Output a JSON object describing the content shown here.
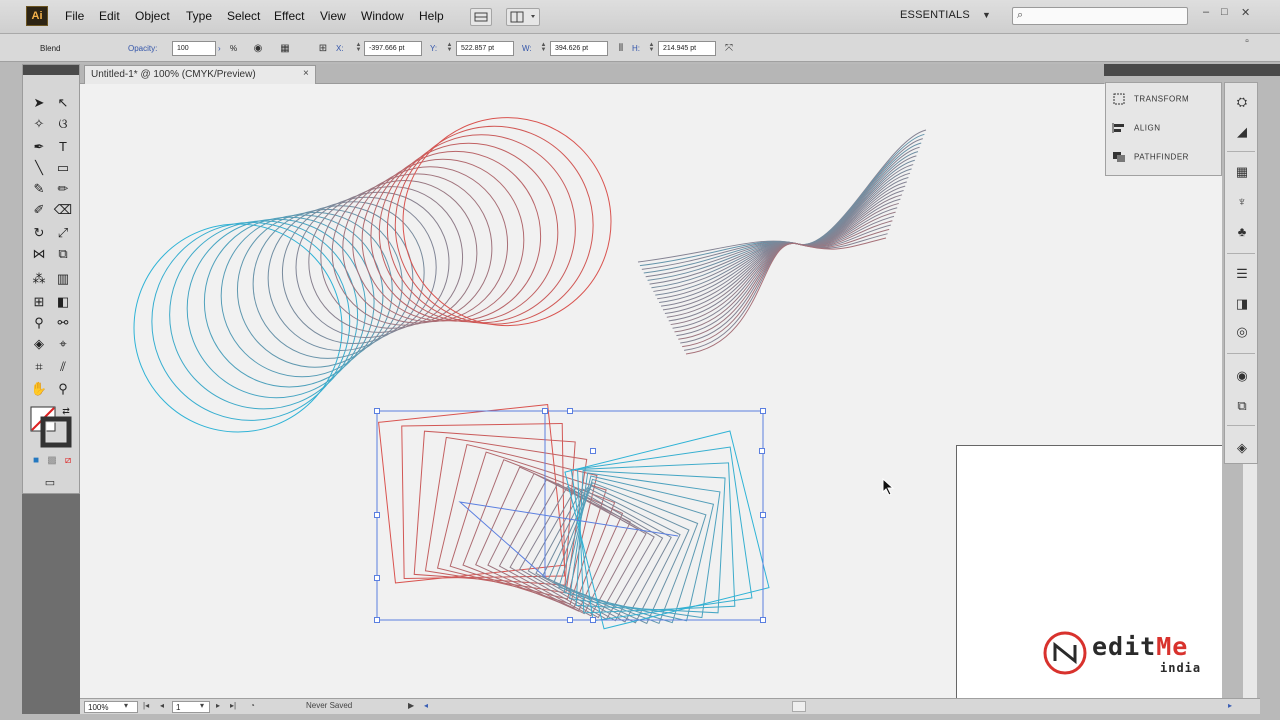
{
  "app": {
    "logo": "Ai"
  },
  "menu": [
    "File",
    "Edit",
    "Object",
    "Type",
    "Select",
    "Effect",
    "View",
    "Window",
    "Help"
  ],
  "workspace": "ESSENTIALS",
  "controls": {
    "object_type": "Blend",
    "opacity_label": "Opacity:",
    "opacity_value": "100",
    "opacity_unit": "%",
    "x_label": "X:",
    "x_value": "-397.666 pt",
    "y_label": "Y:",
    "y_value": "522.857 pt",
    "w_label": "W:",
    "w_value": "394.626 pt",
    "h_label": "H:",
    "h_value": "214.945 pt"
  },
  "document": {
    "tab_title": "Untitled-1* @ 100% (CMYK/Preview)",
    "close": "×"
  },
  "panels": [
    {
      "label": "TRANSFORM",
      "icon": "transform-icon"
    },
    {
      "label": "ALIGN",
      "icon": "align-icon"
    },
    {
      "label": "PATHFINDER",
      "icon": "pathfinder-icon"
    }
  ],
  "status": {
    "zoom": "100%",
    "page": "1",
    "save_state": "Never Saved"
  },
  "watermark": {
    "brand_prefix": "edit",
    "brand_suffix": "Me",
    "sub": "india"
  },
  "colors": {
    "blend_red": "#d9534f",
    "blend_blue": "#2fb3d6",
    "selection": "#5b7fe0"
  }
}
